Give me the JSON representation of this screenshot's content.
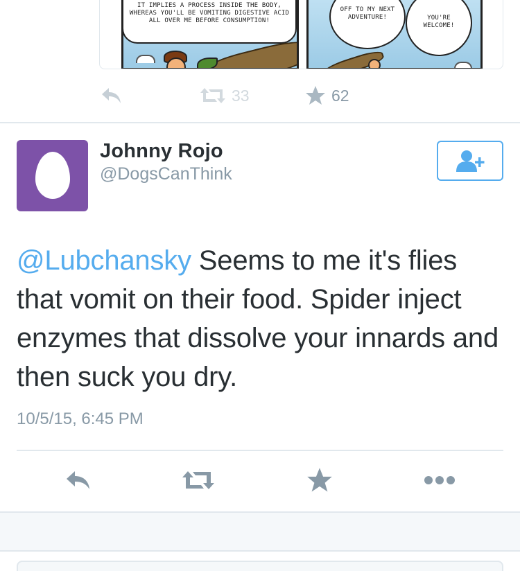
{
  "previous_tweet": {
    "comic": {
      "panel1_text": "IT IMPLIES A PROCESS INSIDE THE BODY, WHEREAS YOU'LL BE VOMITING DIGESTIVE ACID ALL OVER ME BEFORE CONSUMPTION!",
      "panel2_bubble1": "OFF TO MY NEXT ADVENTURE!",
      "panel2_bubble2": "YOU'RE WELCOME!"
    },
    "retweet_count": "33",
    "favorite_count": "62"
  },
  "tweet": {
    "author_name": "Johnny Rojo",
    "author_handle": "@DogsCanThink",
    "mention": "@Lubchansky",
    "text": " Seems to me it's flies that vomit on their food. Spider inject enzymes that dissolve your innards and then suck you dry.",
    "timestamp": "10/5/15, 6:45 PM"
  },
  "icons": {
    "reply": "reply-icon",
    "retweet": "retweet-icon",
    "favorite": "star-icon",
    "more": "more-dots-icon",
    "follow": "add-user-icon"
  },
  "colors": {
    "accent": "#55acee",
    "muted": "#8899a6",
    "text": "#292f33",
    "avatar_bg": "#7d52a8",
    "divider": "#e1e8ed"
  }
}
